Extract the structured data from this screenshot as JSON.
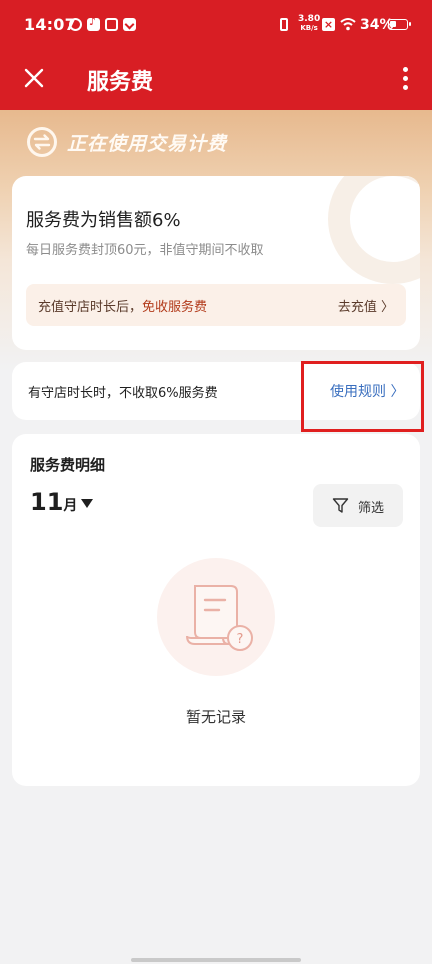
{
  "status_bar": {
    "time": "14:07",
    "net_speed": "3.80",
    "net_unit": "KB/s",
    "battery": "34%"
  },
  "nav": {
    "title": "服务费"
  },
  "hero": {
    "title": "正在使用交易计费"
  },
  "fee_card": {
    "title": "服务费为销售额6%",
    "subtitle": "每日服务费封顶60元，非值守期间不收取",
    "recharge_prefix": "充值守店时长后，",
    "recharge_highlight": "免收服务费",
    "recharge_link": "去充值 〉"
  },
  "rule_card": {
    "text": "有守店时长时，不收取6%服务费",
    "link": "使用规则 〉"
  },
  "detail": {
    "title": "服务费明细",
    "month_number": "11",
    "month_unit": "月",
    "filter_label": "筛选",
    "empty_text": "暂无记录"
  },
  "colors": {
    "brand_red": "#d81e24",
    "link_blue": "#3a6fbf",
    "highlight_red": "#e01f1f"
  },
  "icons": {
    "close": "close-icon",
    "more": "more-vertical-icon",
    "exchange": "exchange-icon",
    "filter": "filter-icon",
    "empty": "empty-document-icon"
  }
}
